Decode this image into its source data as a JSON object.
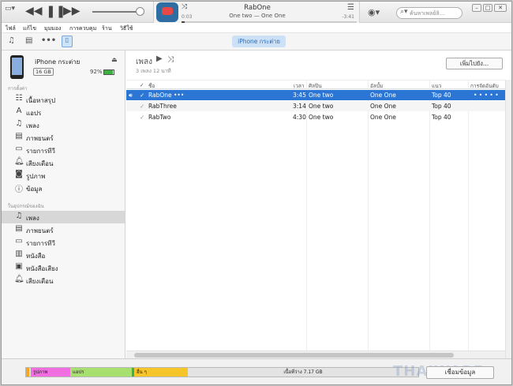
{
  "player": {
    "now_playing_title": "RabOne",
    "now_playing_subtitle": "One two — One One",
    "elapsed": "0:03",
    "remaining": "-3:41",
    "search_placeholder": "ค้นหาเพลย์ลิ...",
    "progress": 0.02
  },
  "menu": [
    "ไฟล์",
    "แก้ไข",
    "มุมมอง",
    "การควบคุม",
    "ร้าน",
    "วิธีใช้"
  ],
  "toolbar": {
    "device_tab": "iPhone กระต่าย"
  },
  "device": {
    "name": "iPhone กระต่าย",
    "capacity": "16 GB",
    "battery": "92%",
    "battery_level": 0.92
  },
  "sidebar": {
    "settings_header": "การตั้งค่า",
    "settings_items": [
      {
        "icon": "summary-icon",
        "label": "เนื้อหาสรุป"
      },
      {
        "icon": "apps-icon",
        "label": "แอปร"
      },
      {
        "icon": "music-icon",
        "label": "เพลง"
      },
      {
        "icon": "film-icon",
        "label": "ภาพยนตร์"
      },
      {
        "icon": "tv-icon",
        "label": "รายการทีวี"
      },
      {
        "icon": "bell-icon",
        "label": "เสียงเตือน"
      },
      {
        "icon": "camera-icon",
        "label": "รูปภาพ"
      },
      {
        "icon": "info-icon",
        "label": "ข้อมูล"
      }
    ],
    "ondevice_header": "ในอุปกรณ์ของฉัน",
    "ondevice_items": [
      {
        "icon": "music-icon",
        "label": "เพลง"
      },
      {
        "icon": "film-icon",
        "label": "ภาพยนตร์"
      },
      {
        "icon": "tv-icon",
        "label": "รายการทีวี"
      },
      {
        "icon": "book-icon",
        "label": "หนังสือ"
      },
      {
        "icon": "audiobook-icon",
        "label": "หนังสือเสียง"
      },
      {
        "icon": "bell-icon",
        "label": "เสียงเตือน"
      }
    ]
  },
  "main": {
    "title": "เพลง",
    "subtitle": "3 เพลง 12 นาที",
    "add_button": "เพิ่มไปยัง...",
    "columns": {
      "name": "ชื่อ",
      "time": "เวลา",
      "artist": "ศิลปิน",
      "album": "อัลบั้ม",
      "genre": "แนว",
      "sort": "การจัดอันดับ"
    },
    "rows": [
      {
        "name": "RabOne",
        "time": "3:45",
        "artist": "One two",
        "album": "One One",
        "genre": "Top 40",
        "rating": "• • • • •"
      },
      {
        "name": "RabThree",
        "time": "3:14",
        "artist": "One two",
        "album": "One One",
        "genre": "Top 40",
        "rating": ""
      },
      {
        "name": "RabTwo",
        "time": "4:30",
        "artist": "One two",
        "album": "One One",
        "genre": "Top 40",
        "rating": ""
      }
    ]
  },
  "capacity": {
    "photos": "รูปภาพ",
    "apps": "แอปร",
    "other": "อื่น ๆ",
    "free": "เนื้อที่ว่าง 7.17 GB",
    "sync_button": "เชื่อมข้อมูล"
  },
  "watermark": "THAIWARE",
  "colors": {
    "selection": "#2b75d5",
    "photos_seg": "#f06ee0",
    "apps_seg": "#a8e070",
    "other_seg": "#f5c52a"
  }
}
